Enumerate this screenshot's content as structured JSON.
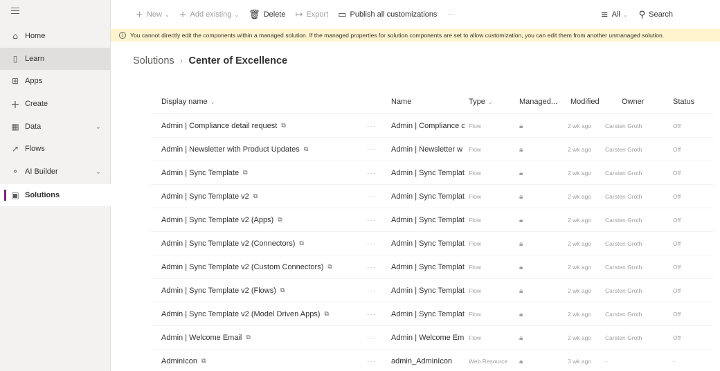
{
  "sidebar": {
    "items": [
      {
        "label": "Home",
        "icon": "home-icon",
        "glyph": "⌂"
      },
      {
        "label": "Learn",
        "icon": "book-icon",
        "glyph": "▯"
      },
      {
        "label": "Apps",
        "icon": "apps-icon",
        "glyph": "⊞"
      },
      {
        "label": "Create",
        "icon": "plus-icon",
        "glyph": "+"
      },
      {
        "label": "Data",
        "icon": "table-icon",
        "glyph": "▦"
      },
      {
        "label": "Flows",
        "icon": "flow-icon",
        "glyph": "↗"
      },
      {
        "label": "AI Builder",
        "icon": "ai-builder-icon",
        "glyph": "⚬"
      },
      {
        "label": "Solutions",
        "icon": "solutions-icon",
        "glyph": "▣"
      }
    ]
  },
  "command_bar": {
    "new_label": "New",
    "add_existing_label": "Add existing",
    "delete_label": "Delete",
    "export_label": "Export",
    "publish_label": "Publish all customizations",
    "more_label": "···",
    "filter_label": "All",
    "search_label": "Search"
  },
  "warning": {
    "text": "You cannot directly edit the components within a managed solution. If the managed properties for solution components are set to allow customization, you can edit them from another unmanaged solution."
  },
  "breadcrumb": {
    "root": "Solutions",
    "separator": "›",
    "current": "Center of Excellence"
  },
  "table": {
    "headers": {
      "display_name": "Display name",
      "name": "Name",
      "type": "Type",
      "managed": "Managed...",
      "modified": "Modified",
      "owner": "Owner",
      "status": "Status"
    },
    "rows": [
      {
        "display": "Admin | Compliance detail request",
        "name": "Admin | Compliance c",
        "type": "Flow",
        "modified": "2 wk ago",
        "owner": "Carsten Groth",
        "status": "Off"
      },
      {
        "display": "Admin | Newsletter with Product Updates",
        "name": "Admin | Newsletter w",
        "type": "Flow",
        "modified": "2 wk ago",
        "owner": "Carsten Groth",
        "status": "Off"
      },
      {
        "display": "Admin | Sync Template",
        "name": "Admin | Sync Templat",
        "type": "Flow",
        "modified": "2 wk ago",
        "owner": "Carsten Groth",
        "status": "Off"
      },
      {
        "display": "Admin | Sync Template v2",
        "name": "Admin | Sync Templat",
        "type": "Flow",
        "modified": "2 wk ago",
        "owner": "Carsten Groth",
        "status": "Off"
      },
      {
        "display": "Admin | Sync Template v2 (Apps)",
        "name": "Admin | Sync Templat",
        "type": "Flow",
        "modified": "2 wk ago",
        "owner": "Carsten Groth",
        "status": "Off"
      },
      {
        "display": "Admin | Sync Template v2 (Connectors)",
        "name": "Admin | Sync Templat",
        "type": "Flow",
        "modified": "2 wk ago",
        "owner": "Carsten Groth",
        "status": "Off"
      },
      {
        "display": "Admin | Sync Template v2 (Custom Connectors)",
        "name": "Admin | Sync Templat",
        "type": "Flow",
        "modified": "2 wk ago",
        "owner": "Carsten Groth",
        "status": "Off"
      },
      {
        "display": "Admin | Sync Template v2 (Flows)",
        "name": "Admin | Sync Templat",
        "type": "Flow",
        "modified": "2 wk ago",
        "owner": "Carsten Groth",
        "status": "Off"
      },
      {
        "display": "Admin | Sync Template v2 (Model Driven Apps)",
        "name": "Admin | Sync Templat",
        "type": "Flow",
        "modified": "2 wk ago",
        "owner": "Carsten Groth",
        "status": "Off"
      },
      {
        "display": "Admin | Welcome Email",
        "name": "Admin | Welcome Em",
        "type": "Flow",
        "modified": "2 wk ago",
        "owner": "Carsten Groth",
        "status": "Off"
      },
      {
        "display": "AdminIcon",
        "name": "admin_AdminIcon",
        "type": "Web Resource",
        "modified": "3 wk ago",
        "owner": "-",
        "status": "-"
      }
    ]
  }
}
